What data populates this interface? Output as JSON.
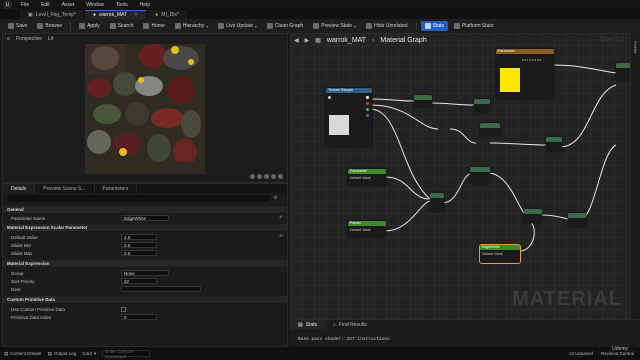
{
  "menubar": {
    "items": [
      "File",
      "Edit",
      "Asset",
      "Window",
      "Tools",
      "Help"
    ]
  },
  "tabs": [
    {
      "label": "Level_Fog_Temp*",
      "active": false
    },
    {
      "label": "warrok_MAT",
      "active": true
    },
    {
      "label": "MI_Dis*",
      "active": false
    }
  ],
  "toolbar": {
    "save": "Save",
    "browse": "Browse",
    "apply": "Apply",
    "search": "Search",
    "home": "Home",
    "hierarchy": "Hierarchy",
    "live_update": "Live Update",
    "clean_graph": "Clean Graph",
    "preview_state": "Preview State",
    "hide_unrelated": "Hide Unrelated",
    "stats": "Stats",
    "platform_stats": "Platform Stats"
  },
  "viewport": {
    "mode": "Perspective",
    "lit": "Lit"
  },
  "details": {
    "tabs": [
      "Details",
      "Preview Scene S...",
      "Parameters"
    ],
    "sections": {
      "general": "General",
      "scalar": "Material Expression Scalar Parameter",
      "expression": "Material Expression",
      "custom": "Custom Primitive Data"
    },
    "rows": {
      "param_name": {
        "label": "Parameter Name",
        "value": "EdgeWhite"
      },
      "default_value": {
        "label": "Default Value",
        "value": "4.0"
      },
      "slider_min": {
        "label": "Slider Min",
        "value": "0.0"
      },
      "slider_max": {
        "label": "Slider Max",
        "value": "0.0"
      },
      "group": {
        "label": "Group",
        "value": "None"
      },
      "sort_priority": {
        "label": "Sort Priority",
        "value": "32"
      },
      "desc": {
        "label": "Desc",
        "value": ""
      },
      "use_custom": {
        "label": "Use Custom Primitive Data",
        "value": ""
      },
      "prim_index": {
        "label": "Primitive Data Index",
        "value": "0"
      }
    }
  },
  "graph": {
    "breadcrumb_asset": "warrok_MAT",
    "breadcrumb_section": "Material Graph",
    "watermark": "MATERIAL",
    "zoom": "Zoom 1:1",
    "nodes": {
      "texture_sample": "Texture Sample",
      "param_1": "Parameter",
      "param_2": "Param",
      "param_default_1": "Default Value",
      "param_default_2": "Default Value",
      "edge_white": "EdgeWhite",
      "edge_default": "Default Value",
      "color_param_title": "Parameter",
      "color_param_values": "0.0 1.0 0.5 0.0"
    }
  },
  "palette": {
    "label": "Palette"
  },
  "stats_panel": {
    "tabs": [
      "Stats",
      "Find Results"
    ],
    "line": "Base pass shader: 257 instructions"
  },
  "statusbar": {
    "content_drawer": "Content Drawer",
    "output_log": "Output Log",
    "cmd": "Cmd",
    "cmd_placeholder": "Enter Console Command",
    "unsaved": "12 Unsaved",
    "revision": "Revision Control"
  },
  "watermark2": "Udemy",
  "colors": {
    "accent": "#1f5fc4",
    "param_green": "#3f8a2f",
    "texture_blue": "#2f5e8a",
    "graph_bg": "#232323"
  }
}
